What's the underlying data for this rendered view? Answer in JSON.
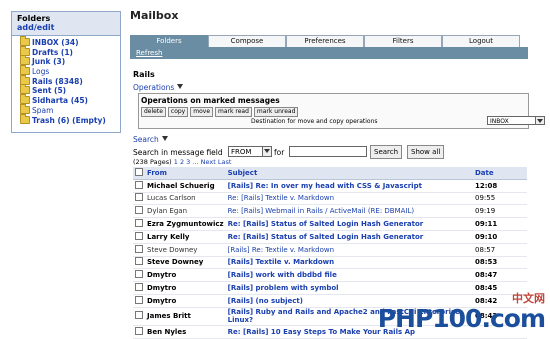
{
  "sidebar": {
    "title": "Folders",
    "edit_link": "add/edit",
    "folders": [
      {
        "label": "INBOX (34)",
        "bold": true
      },
      {
        "label": "Drafts (1)",
        "bold": true
      },
      {
        "label": "Junk (3)",
        "bold": true
      },
      {
        "label": "Logs",
        "bold": false
      },
      {
        "label": "Rails (8348)",
        "bold": true
      },
      {
        "label": "Sent (5)",
        "bold": true
      },
      {
        "label": "Sidharta (45)",
        "bold": true
      },
      {
        "label": "Spam",
        "bold": false
      },
      {
        "label": "Trash (6) (Empty)",
        "bold": true
      }
    ]
  },
  "page": {
    "title": "Mailbox"
  },
  "tabs": [
    "Folders",
    "Compose",
    "Preferences",
    "Filters",
    "Logout"
  ],
  "subbar": {
    "refresh": "Refresh"
  },
  "folder_name": "Rails",
  "operations": {
    "toggle": "Operations",
    "header": "Operations on marked messages",
    "buttons": [
      "delete",
      "copy",
      "move",
      "mark read",
      "mark unread"
    ],
    "dest_label": "Destination for move and copy operations",
    "dest_value": "INBOX"
  },
  "search": {
    "toggle": "Search",
    "label": "Search in message field",
    "field_value": "FROM",
    "for_label": "for",
    "input_value": "",
    "search_button": "Search",
    "show_all_button": "Show all"
  },
  "pager": {
    "pages": "(238 Pages)",
    "page_links": "1 2 3 ...",
    "next": "Next",
    "last": "Last"
  },
  "table": {
    "headers": {
      "from": "From",
      "subject": "Subject",
      "date": "Date"
    },
    "rows": [
      {
        "from": "Michael Schuerig",
        "subject": "[Rails] Re: In over my head with CSS & Javascript",
        "date": "12:08",
        "unread": true
      },
      {
        "from": "Lucas Carlson",
        "subject": "Re: [Rails] Textile v. Markdown",
        "date": "09:55",
        "unread": false
      },
      {
        "from": "Dylan Egan",
        "subject": "Re: [Rails] Webmail in Rails / ActiveMail (RE: DBMAIL)",
        "date": "09:19",
        "unread": false
      },
      {
        "from": "Ezra Zygmuntowicz",
        "subject": "Re: [Rails] Status of Salted Login Hash Generator",
        "date": "09:11",
        "unread": true
      },
      {
        "from": "Larry Kelly",
        "subject": "Re: [Rails] Status of Salted Login Hash Generator",
        "date": "09:10",
        "unread": true
      },
      {
        "from": "Steve Downey",
        "subject": "[Rails] Re: Textile v. Markdown",
        "date": "08:57",
        "unread": false
      },
      {
        "from": "Steve Downey",
        "subject": "[Rails] Textile v. Markdown",
        "date": "08:53",
        "unread": true
      },
      {
        "from": "Dmytro",
        "subject": "[Rails] work with dbdbd file",
        "date": "08:47",
        "unread": true
      },
      {
        "from": "Dmytro",
        "subject": "[Rails] problem with symbol",
        "date": "08:45",
        "unread": true
      },
      {
        "from": "Dmytro",
        "subject": "[Rails] (no subject)",
        "date": "08:42",
        "unread": true
      },
      {
        "from": "James Britt",
        "subject": "[Rails] Ruby and Rails and Apache2 and FastCgi Enterprise Linux?",
        "date": "08:42",
        "unread": true
      },
      {
        "from": "Ben Nyles",
        "subject": "Re: [Rails] 10 Easy Steps To Make Your Rails Ap",
        "date": "",
        "unread": true
      }
    ]
  },
  "watermark": {
    "cn": "中文网",
    "text": "PHP100.com"
  },
  "colors": {
    "tab_active": "#6b8da3",
    "link": "#1a3fae",
    "header_bg": "#dfe6f2"
  }
}
